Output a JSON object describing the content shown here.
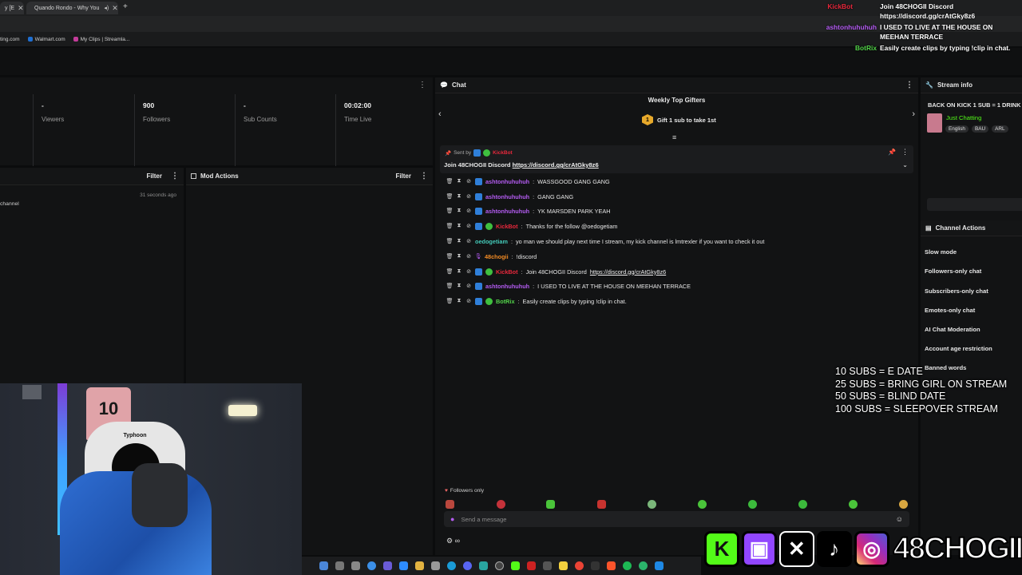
{
  "tabs": [
    {
      "label": "y [E",
      "x": "✕"
    },
    {
      "label": "Quando Rondo - Why You",
      "x": "✕"
    },
    {
      "label": "+"
    }
  ],
  "bookmarks": [
    "ting.com",
    "Walmart.com",
    "My Clips | Streamla..."
  ],
  "stats": [
    {
      "value": "-",
      "label": "Viewers"
    },
    {
      "value": "900",
      "label": "Followers"
    },
    {
      "value": "-",
      "label": "Sub Counts"
    },
    {
      "value": "00:02:00",
      "label": "Time Live"
    }
  ],
  "left_panel": {
    "filter": "Filter",
    "timestamp": "31 seconds ago",
    "text": "channel"
  },
  "mod_actions": {
    "title": "Mod Actions",
    "filter": "Filter"
  },
  "chat": {
    "title": "Chat",
    "gifters_title": "Weekly Top Gifters",
    "gift_rank": "1",
    "gift_text": "Gift 1 sub to take 1st",
    "pinned_by": "Sent by",
    "pinned_user": "KickBot",
    "pinned_text": "Join 48CHOGII Discord ",
    "pinned_link": "https://discord.gg/crAtGky8z6",
    "messages": [
      {
        "user": "ashtonhuhuhuh",
        "text": "WASSGOOD GANG GANG",
        "color": "#b45cf2"
      },
      {
        "user": "ashtonhuhuhuh",
        "text": "GANG GANG",
        "color": "#b45cf2"
      },
      {
        "user": "ashtonhuhuhuh",
        "text": "YK MARSDEN PARK YEAH",
        "color": "#b45cf2"
      },
      {
        "user": "KickBot",
        "text": "Thanks for the follow @oedogetiam",
        "color": "#e8283c"
      },
      {
        "user": "oedogetiam",
        "text": "yo man we should play next time I stream, my kick channel is lmtrexler if you want to check it out",
        "color": "#44c9b8"
      },
      {
        "user": "48chogii",
        "text": "!discord",
        "color": "#f08a24"
      },
      {
        "user": "KickBot",
        "text": "Join 48CHOGII Discord ",
        "link": "https://discord.gg/crAtGky8z6",
        "color": "#e8283c"
      },
      {
        "user": "ashtonhuhuhuh",
        "text": "I USED TO LIVE AT THE HOUSE ON MEEHAN TERRACE",
        "color": "#b45cf2"
      },
      {
        "user": "BotRix",
        "text": "Easily create clips by typing !clip in chat.",
        "color": "#53d44a"
      }
    ],
    "followers_only": "Followers only",
    "placeholder": "Send a message"
  },
  "stream_info": {
    "title": "Stream info",
    "stream_title": "BACK ON KICK 1 SUB = 1 DRINK",
    "category": "Just Chatting",
    "tags": [
      "English",
      "BAU",
      "ARL"
    ]
  },
  "channel_actions": {
    "title": "Channel Actions",
    "items": [
      "Slow mode",
      "Followers-only chat",
      "Subscribers-only chat",
      "Emotes-only chat",
      "AI Chat Moderation",
      "Account age restriction",
      "Banned words"
    ]
  },
  "overlay_chat": [
    {
      "user": "KickBot",
      "text": "Join 48CHOGII Discord",
      "color": "#e8283c"
    },
    {
      "user": "",
      "text": "https://discord.gg/crAtGky8z6",
      "color": "#ffffff"
    },
    {
      "user": "ashtonhuhuhuh",
      "text": "I USED TO LIVE AT THE HOUSE ON",
      "color": "#b45cf2"
    },
    {
      "user": "",
      "text": "MEEHAN TERRACE",
      "color": "#ffffff"
    },
    {
      "user": "BotRix",
      "text": "Easily create clips by typing !clip in chat.",
      "color": "#53d44a"
    }
  ],
  "sub_goals": [
    "10 SUBS = E DATE",
    "25 SUBS = BRING GIRL ON STREAM",
    "50 SUBS = BLIND DATE",
    "100 SUBS = SLEEPOVER STREAM"
  ],
  "webcam": {
    "jersey": "10",
    "chair_brand": "Typhoon"
  },
  "handle": "48CHOGII",
  "colors": {
    "kick_green": "#53fc18",
    "twitch": "#9146ff",
    "instagram": "#d62976"
  }
}
